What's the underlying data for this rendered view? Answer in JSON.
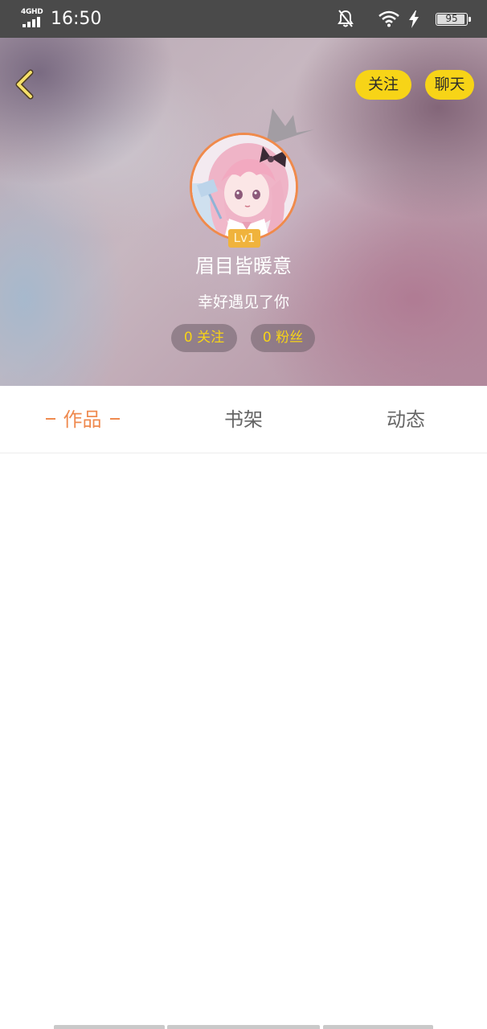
{
  "status_bar": {
    "network_label": "4GHD",
    "time": "16:50",
    "battery_percent": "95",
    "battery_level": 0.95,
    "icons": [
      "signal-icon",
      "mute-bell-icon",
      "wifi-icon",
      "charging-icon",
      "battery-icon"
    ]
  },
  "header": {
    "back_icon": "chevron-left-icon",
    "follow_label": "关注",
    "chat_label": "聊天",
    "crown_icon": "crown-icon",
    "level": "Lv1",
    "username": "眉目皆暖意",
    "bio": "幸好遇见了你",
    "following_stat": "0 关注",
    "fans_stat": "0 粉丝"
  },
  "tabs": {
    "items": [
      {
        "label": "作品",
        "active": true
      },
      {
        "label": "书架",
        "active": false
      },
      {
        "label": "动态",
        "active": false
      }
    ]
  },
  "colors": {
    "accent": "#ef8a4f",
    "button_yellow": "#f7d417",
    "status_bar_bg": "#4a4a4a",
    "level_badge": "#f0b33c",
    "tab_inactive": "#666666"
  }
}
